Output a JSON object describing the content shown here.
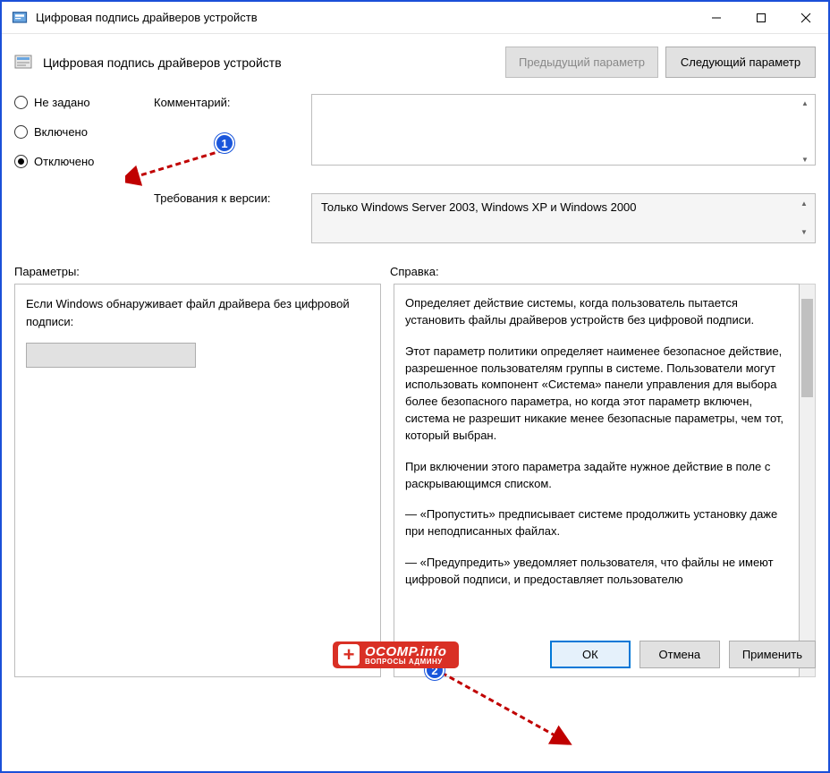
{
  "titlebar": {
    "title": "Цифровая подпись драйверов устройств"
  },
  "header": {
    "title": "Цифровая подпись драйверов устройств"
  },
  "nav": {
    "prev": "Предыдущий параметр",
    "next": "Следующий параметр"
  },
  "radios": {
    "not_configured": "Не задано",
    "enabled": "Включено",
    "disabled": "Отключено"
  },
  "labels": {
    "comment": "Комментарий:",
    "requirements": "Требования к версии:",
    "options": "Параметры:",
    "help": "Справка:"
  },
  "comment_value": "",
  "requirements_value": "Только Windows Server 2003, Windows XP и Windows 2000",
  "options_text": "Если Windows обнаруживает файл драйвера без цифровой подписи:",
  "help": {
    "p1": "Определяет действие системы, когда пользователь пытается установить файлы драйверов устройств без цифровой подписи.",
    "p2": "Этот параметр политики определяет наименее безопасное действие, разрешенное пользователям группы в системе. Пользователи могут использовать компонент «Система» панели управления для выбора более безопасного параметра, но когда этот параметр включен, система не разрешит никакие менее безопасные параметры, чем тот, который выбран.",
    "p3": "При включении этого параметра задайте нужное действие в поле с раскрывающимся списком.",
    "p4": "— «Пропустить» предписывает системе продолжить установку даже при неподписанных файлах.",
    "p5": "— «Предупредить» уведомляет пользователя, что файлы не имеют цифровой подписи, и предоставляет пользователю"
  },
  "footer": {
    "ok": "ОК",
    "cancel": "Отмена",
    "apply": "Применить"
  },
  "watermark": {
    "main": "OCOMP.info",
    "sub": "ВОПРОСЫ АДМИНУ"
  },
  "badges": {
    "b1": "1",
    "b2": "2"
  }
}
